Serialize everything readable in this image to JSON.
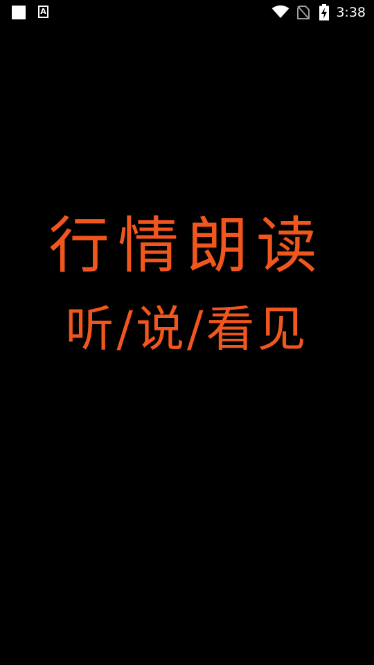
{
  "status_bar": {
    "time": "3:38",
    "notification_icons": [
      "app-notification-square-icon",
      "font-a-icon"
    ],
    "system_icons": [
      "wifi-icon",
      "no-sim-icon",
      "battery-charging-icon"
    ],
    "font_icon_letter": "A"
  },
  "splash": {
    "title": "行情朗读",
    "subtitle": "听/说/看见",
    "text_color": "#f0561e",
    "background_color": "#000000"
  }
}
